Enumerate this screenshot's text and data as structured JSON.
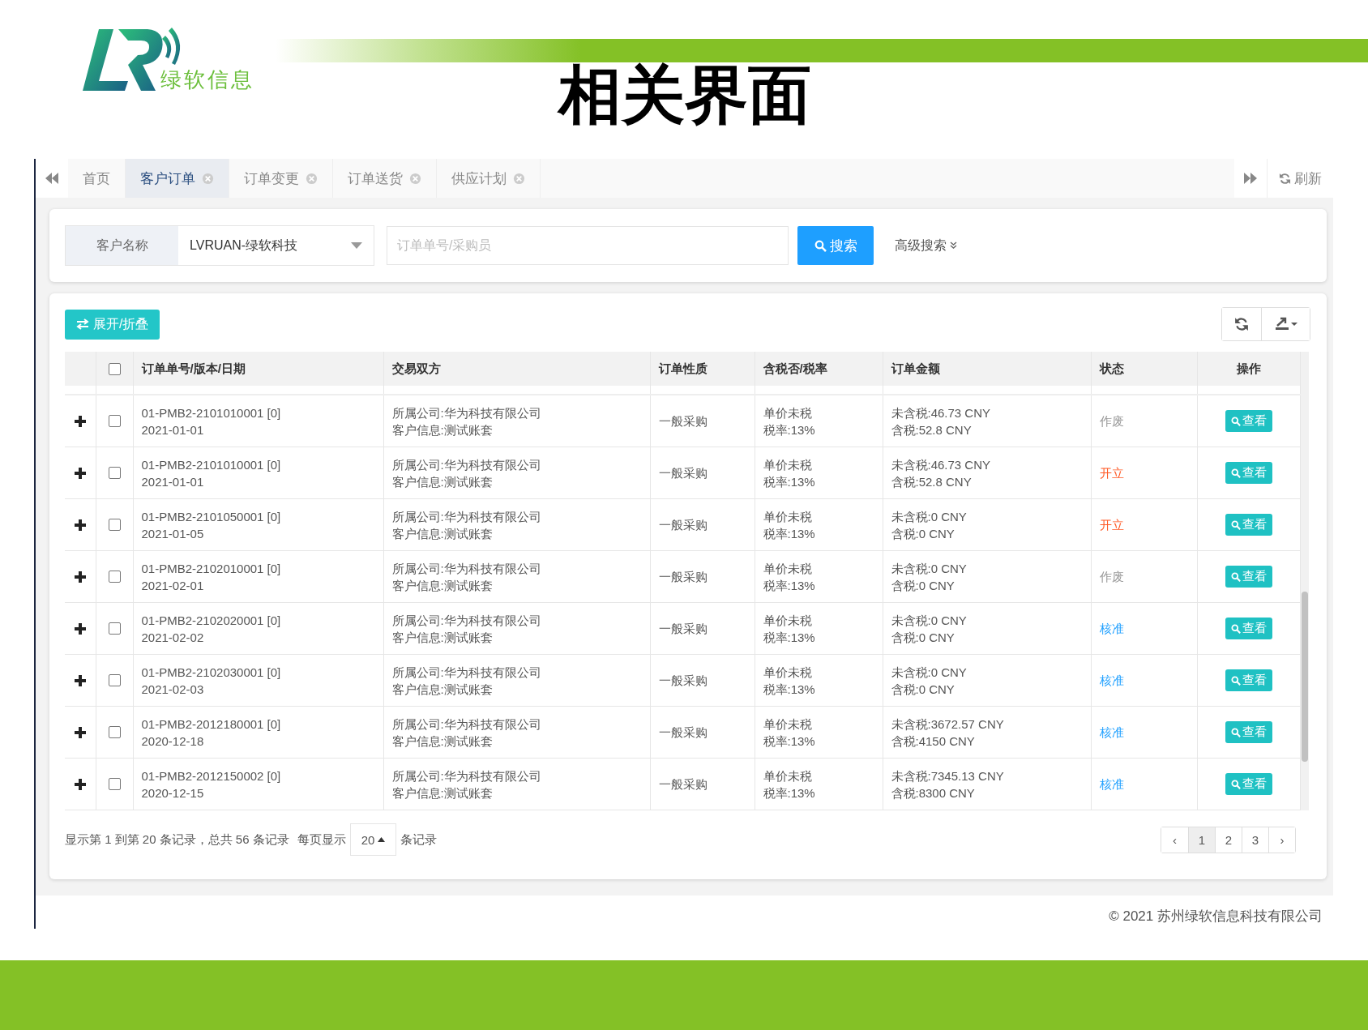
{
  "header": {
    "brand": "绿软信息",
    "title": "相关界面"
  },
  "tabs": [
    {
      "label": "首页",
      "selected": false,
      "closable": false
    },
    {
      "label": "客户订单",
      "selected": true,
      "closable": true
    },
    {
      "label": "订单变更",
      "selected": false,
      "closable": true
    },
    {
      "label": "订单送货",
      "selected": false,
      "closable": true
    },
    {
      "label": "供应计划",
      "selected": false,
      "closable": true
    }
  ],
  "refresh": "刷新",
  "search": {
    "label": "客户名称",
    "value": "LVRUAN-绿软科技",
    "placeholder": "订单单号/采购员",
    "button": "搜索",
    "advanced": "高级搜索"
  },
  "table": {
    "toggle_button": "展开/折叠",
    "header_checked": false,
    "columns": [
      "订单单号/版本/日期",
      "交易双方",
      "订单性质",
      "含税否/税率",
      "订单金额",
      "状态",
      "操作"
    ],
    "rows": [
      {
        "checked": false,
        "order_no": "01-PMB2-2101010001 [0]",
        "date": "2021-01-01",
        "company": "所属公司:华为科技有限公司",
        "customer": "客户信息:测试账套",
        "type": "一般采购",
        "tax_mode": "单价未税",
        "tax_rate": "税率:13%",
        "amount_ex": "未含税:46.73 CNY",
        "amount_inc": "含税:52.8 CNY",
        "status": "作废",
        "color": "#999999",
        "action": "查看"
      },
      {
        "checked": false,
        "order_no": "01-PMB2-2101010001 [0]",
        "date": "2021-01-01",
        "company": "所属公司:华为科技有限公司",
        "customer": "客户信息:测试账套",
        "type": "一般采购",
        "tax_mode": "单价未税",
        "tax_rate": "税率:13%",
        "amount_ex": "未含税:46.73 CNY",
        "amount_inc": "含税:52.8 CNY",
        "status": "开立",
        "color": "#ff5722",
        "action": "查看"
      },
      {
        "checked": false,
        "order_no": "01-PMB2-2101050001 [0]",
        "date": "2021-01-05",
        "company": "所属公司:华为科技有限公司",
        "customer": "客户信息:测试账套",
        "type": "一般采购",
        "tax_mode": "单价未税",
        "tax_rate": "税率:13%",
        "amount_ex": "未含税:0 CNY",
        "amount_inc": "含税:0 CNY",
        "status": "开立",
        "color": "#ff5722",
        "action": "查看"
      },
      {
        "checked": false,
        "order_no": "01-PMB2-2102010001 [0]",
        "date": "2021-02-01",
        "company": "所属公司:华为科技有限公司",
        "customer": "客户信息:测试账套",
        "type": "一般采购",
        "tax_mode": "单价未税",
        "tax_rate": "税率:13%",
        "amount_ex": "未含税:0 CNY",
        "amount_inc": "含税:0 CNY",
        "status": "作废",
        "color": "#999999",
        "action": "查看"
      },
      {
        "checked": false,
        "order_no": "01-PMB2-2102020001 [0]",
        "date": "2021-02-02",
        "company": "所属公司:华为科技有限公司",
        "customer": "客户信息:测试账套",
        "type": "一般采购",
        "tax_mode": "单价未税",
        "tax_rate": "税率:13%",
        "amount_ex": "未含税:0 CNY",
        "amount_inc": "含税:0 CNY",
        "status": "核准",
        "color": "#1e9fff",
        "action": "查看"
      },
      {
        "checked": false,
        "order_no": "01-PMB2-2102030001 [0]",
        "date": "2021-02-03",
        "company": "所属公司:华为科技有限公司",
        "customer": "客户信息:测试账套",
        "type": "一般采购",
        "tax_mode": "单价未税",
        "tax_rate": "税率:13%",
        "amount_ex": "未含税:0 CNY",
        "amount_inc": "含税:0 CNY",
        "status": "核准",
        "color": "#1e9fff",
        "action": "查看"
      },
      {
        "checked": false,
        "order_no": "01-PMB2-2012180001 [0]",
        "date": "2020-12-18",
        "company": "所属公司:华为科技有限公司",
        "customer": "客户信息:测试账套",
        "type": "一般采购",
        "tax_mode": "单价未税",
        "tax_rate": "税率:13%",
        "amount_ex": "未含税:3672.57 CNY",
        "amount_inc": "含税:4150 CNY",
        "status": "核准",
        "color": "#1e9fff",
        "action": "查看"
      },
      {
        "checked": false,
        "order_no": "01-PMB2-2012150002 [0]",
        "date": "2020-12-15",
        "company": "所属公司:华为科技有限公司",
        "customer": "客户信息:测试账套",
        "type": "一般采购",
        "tax_mode": "单价未税",
        "tax_rate": "税率:13%",
        "amount_ex": "未含税:7345.13 CNY",
        "amount_inc": "含税:8300 CNY",
        "status": "核准",
        "color": "#1e9fff",
        "action": "查看"
      }
    ]
  },
  "pagination": {
    "summary": "显示第 1 到第 20 条记录，总共 56 条记录",
    "per_page_label": "每页显示",
    "page_size": "20",
    "per_page_suffix": "条记录",
    "prev": "‹",
    "next": "›",
    "pages": [
      {
        "label": "1",
        "selected": true
      },
      {
        "label": "2",
        "selected": false
      },
      {
        "label": "3",
        "selected": false
      }
    ]
  },
  "footer": "© 2021 苏州绿软信息科技有限公司"
}
